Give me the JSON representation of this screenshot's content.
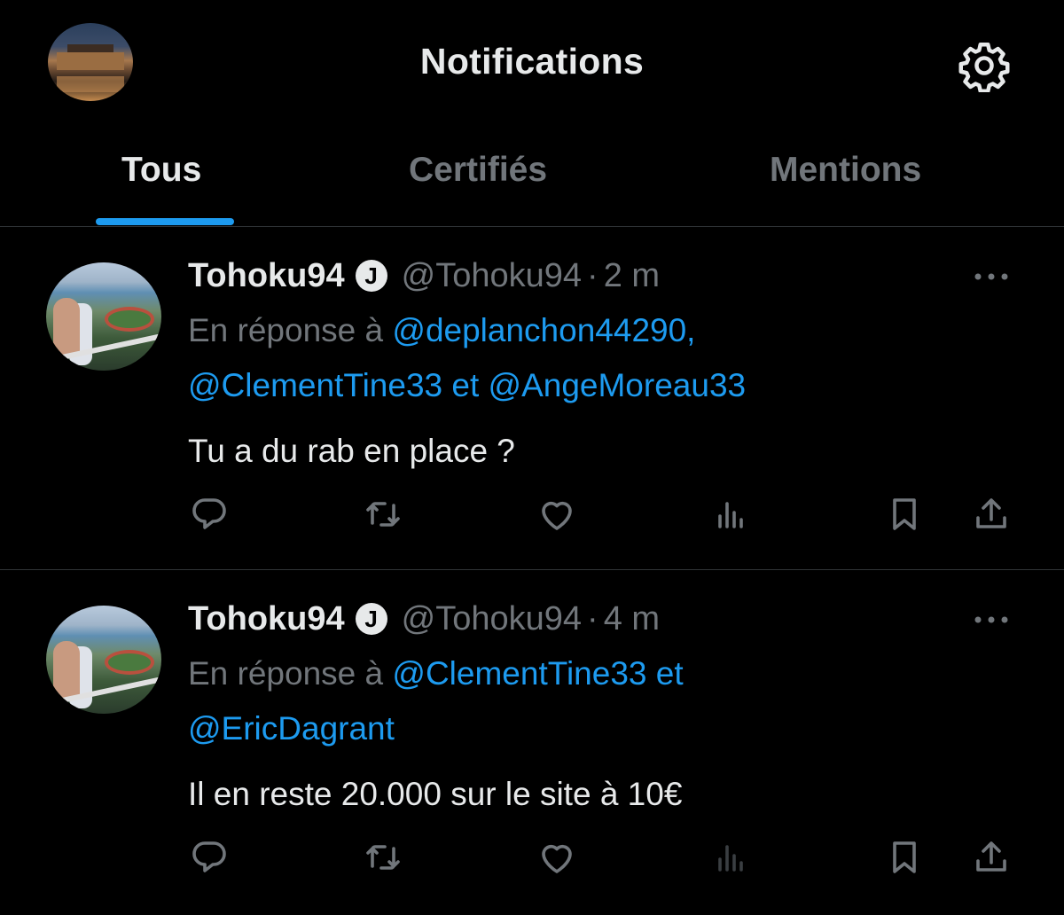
{
  "header": {
    "title": "Notifications"
  },
  "tabs": [
    {
      "label": "Tous",
      "active": true
    },
    {
      "label": "Certifiés",
      "active": false
    },
    {
      "label": "Mentions",
      "active": false
    }
  ],
  "tweets": [
    {
      "name": "Tohoku94",
      "badge": "J",
      "handle": "@Tohoku94",
      "separator": "·",
      "time": "2 m",
      "reply_prefix": "En réponse à",
      "reply_mention_1": "@deplanchon44290,",
      "reply_mention_2": "@ClementTine33",
      "reply_joiner": "et",
      "reply_mention_3": "@AngeMoreau33",
      "text": "Tu a du rab en place ?"
    },
    {
      "name": "Tohoku94",
      "badge": "J",
      "handle": "@Tohoku94",
      "separator": "·",
      "time": "4 m",
      "reply_prefix": "En réponse à",
      "reply_mention_1": "@ClementTine33",
      "reply_joiner": "et",
      "reply_mention_2": "@EricDagrant",
      "text": "Il en reste 20.000 sur le site à 10€"
    }
  ],
  "icons": {
    "settings": "gear-icon",
    "more": "more-dots-icon",
    "reply": "reply-icon",
    "retweet": "retweet-icon",
    "like": "heart-icon",
    "views": "views-icon",
    "bookmark": "bookmark-icon",
    "share": "share-icon"
  },
  "colors": {
    "background": "#000000",
    "accent": "#1d9bf0",
    "text_primary": "#e7e9ea",
    "text_secondary": "#71767b",
    "divider": "#2f3336"
  }
}
